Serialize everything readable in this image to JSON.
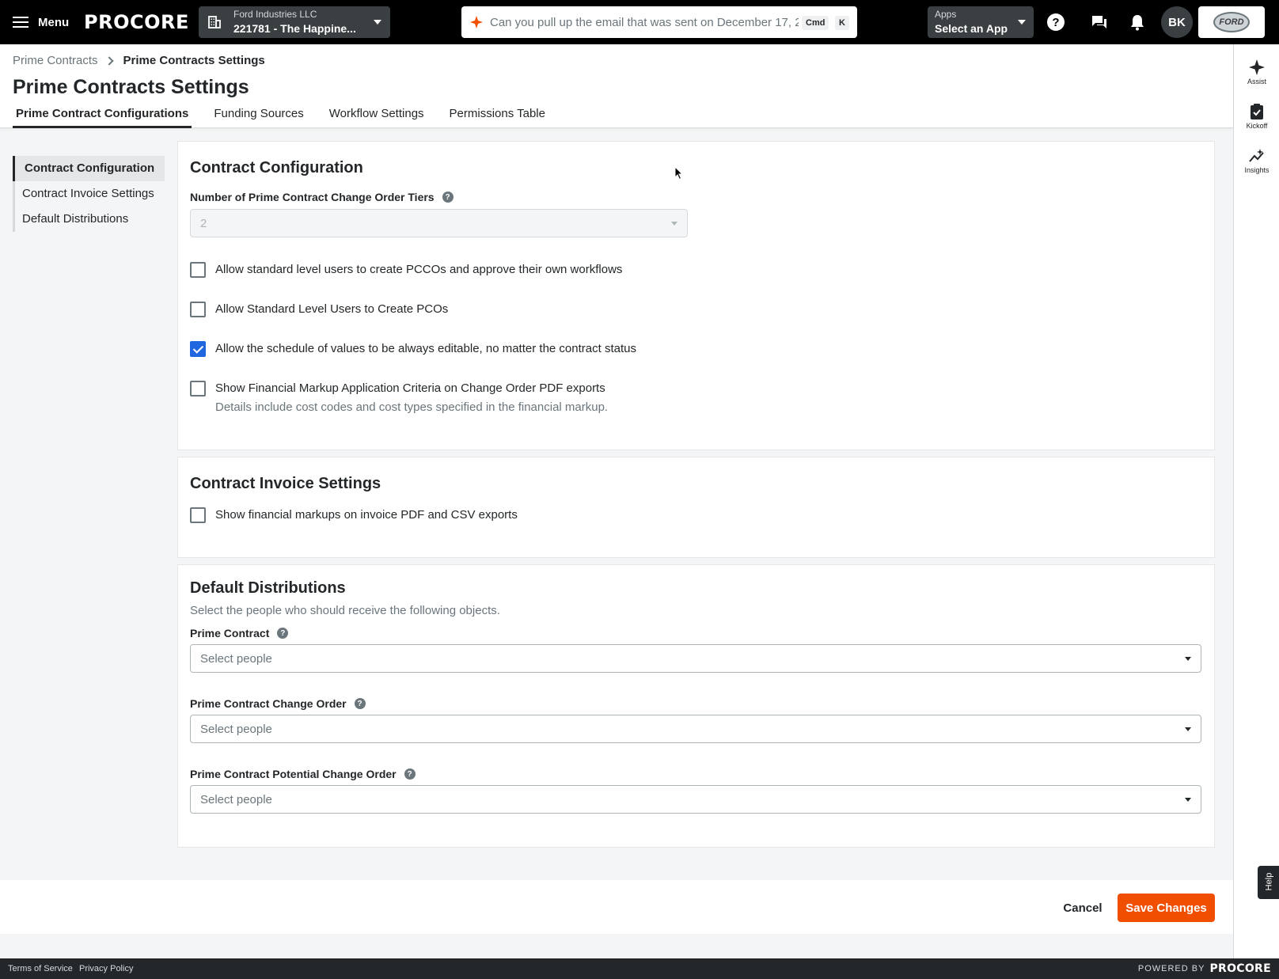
{
  "topbar": {
    "menu_label": "Menu",
    "logo_text": "PROCORE",
    "company": "Ford Industries LLC",
    "project": "221781 - The Happine...",
    "search_placeholder": "Can you pull up the email that was sent on December 17, 2",
    "kbd_cmd": "Cmd",
    "kbd_k": "K",
    "apps_label": "Apps",
    "apps_value": "Select an App",
    "avatar_initials": "BK",
    "company_logo_text": "FORD",
    "accent_color": "#f04e00"
  },
  "rail": {
    "items": [
      {
        "label": "Assist",
        "icon": "sparkle-icon"
      },
      {
        "label": "Kickoff",
        "icon": "clipboard-check-icon"
      },
      {
        "label": "Insights",
        "icon": "insights-icon"
      }
    ],
    "help_label": "Help"
  },
  "breadcrumb": {
    "parent": "Prime Contracts",
    "current": "Prime Contracts Settings"
  },
  "page_title": "Prime Contracts Settings",
  "tabs": [
    {
      "label": "Prime Contract Configurations",
      "active": true
    },
    {
      "label": "Funding Sources",
      "active": false
    },
    {
      "label": "Workflow Settings",
      "active": false
    },
    {
      "label": "Permissions Table",
      "active": false
    }
  ],
  "side_nav": [
    {
      "label": "Contract Configuration",
      "active": true
    },
    {
      "label": "Contract Invoice Settings",
      "active": false
    },
    {
      "label": "Default Distributions",
      "active": false
    }
  ],
  "contract_configuration": {
    "title": "Contract Configuration",
    "tiers_label": "Number of Prime Contract Change Order Tiers",
    "tiers_value": "2",
    "checkboxes": [
      {
        "label": "Allow standard level users to create PCCOs and approve their own workflows",
        "checked": false
      },
      {
        "label": "Allow Standard Level Users to Create PCOs",
        "checked": false
      },
      {
        "label": "Allow the schedule of values to be always editable, no matter the contract status",
        "checked": true
      },
      {
        "label": "Show Financial Markup Application Criteria on Change Order PDF exports",
        "sub": "Details include cost codes and cost types specified in the financial markup.",
        "checked": false
      }
    ]
  },
  "invoice_settings": {
    "title": "Contract Invoice Settings",
    "checkbox": {
      "label": "Show financial markups on invoice PDF and CSV exports",
      "checked": false
    }
  },
  "default_distributions": {
    "title": "Default Distributions",
    "description": "Select the people who should receive the following objects.",
    "fields": [
      {
        "label": "Prime Contract",
        "placeholder": "Select people"
      },
      {
        "label": "Prime Contract Change Order",
        "placeholder": "Select people"
      },
      {
        "label": "Prime Contract Potential Change Order",
        "placeholder": "Select people"
      }
    ]
  },
  "actions": {
    "cancel": "Cancel",
    "save": "Save Changes"
  },
  "footer": {
    "terms": "Terms of Service",
    "privacy": "Privacy Policy",
    "powered_by": "POWERED BY",
    "powered_logo": "PROCORE"
  }
}
